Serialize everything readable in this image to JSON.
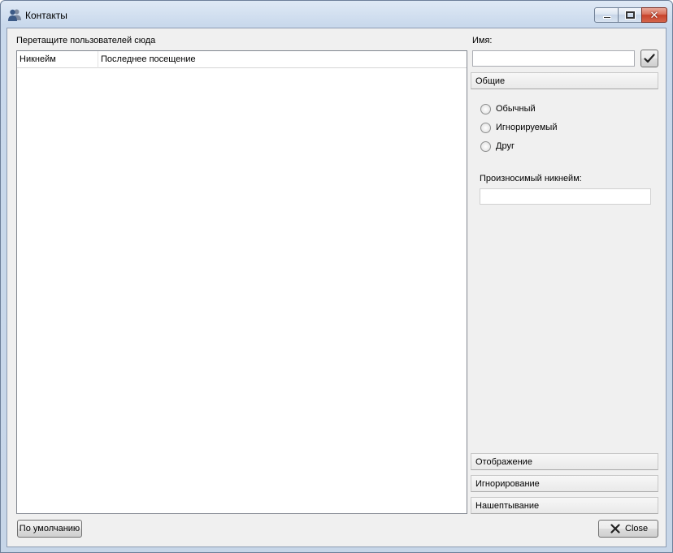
{
  "window": {
    "title": "Контакты",
    "icon": "contacts-icon"
  },
  "left": {
    "drag_label": "Перетащите пользователей сюда",
    "columns": [
      "Никнейм",
      "Последнее посещение"
    ],
    "rows": []
  },
  "right": {
    "name_label": "Имя:",
    "name_value": "",
    "apply_icon": "checkmark-icon",
    "sections": {
      "general": "Общие",
      "display": "Отображение",
      "ignore": "Игнорирование",
      "whisper": "Нашептывание"
    },
    "radios": [
      {
        "label": "Обычный",
        "checked": false
      },
      {
        "label": "Игнорируемый",
        "checked": false
      },
      {
        "label": "Друг",
        "checked": false
      }
    ],
    "pron_label": "Произносимый никнейм:",
    "pron_value": ""
  },
  "buttons": {
    "default_label": "По умолчанию",
    "close_label": "Close"
  }
}
